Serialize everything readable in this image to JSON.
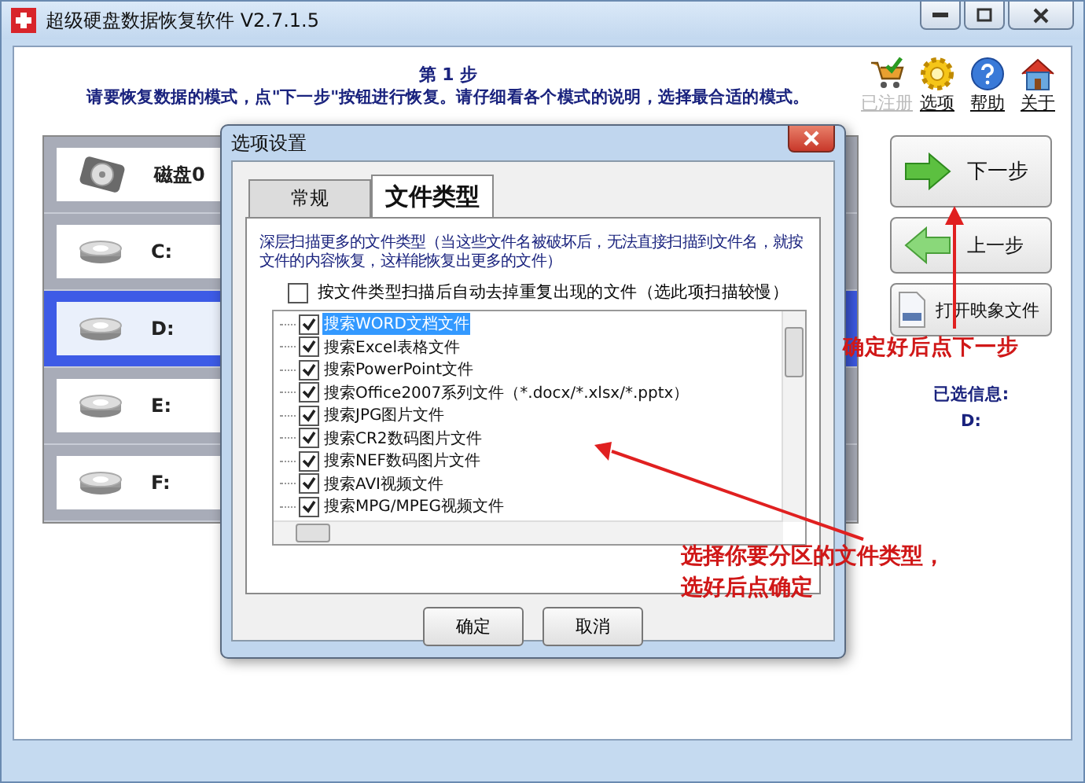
{
  "window": {
    "title": "超级硬盘数据恢复软件 V2.7.1.5"
  },
  "header": {
    "step": "第 1 步",
    "instruction": "请要恢复数据的模式，点\"下一步\"按钮进行恢复。请仔细看各个模式的说明，选择最合适的模式。"
  },
  "toolbar": [
    {
      "kind": "cart",
      "label": "已注册",
      "disabled": true
    },
    {
      "kind": "gear",
      "label": "选项",
      "disabled": false
    },
    {
      "kind": "help",
      "label": "帮助",
      "disabled": false
    },
    {
      "kind": "home",
      "label": "关于",
      "disabled": false
    }
  ],
  "drives": [
    {
      "kind": "disk",
      "label": "磁盘0",
      "selected": false
    },
    {
      "kind": "partition",
      "label": "C:",
      "selected": false
    },
    {
      "kind": "partition",
      "label": "D:",
      "selected": true
    },
    {
      "kind": "partition",
      "label": "E:",
      "selected": false
    },
    {
      "kind": "partition",
      "label": "F:",
      "selected": false
    }
  ],
  "actions": [
    {
      "kind": "next",
      "label": "下一步"
    },
    {
      "kind": "back",
      "label": "上一步"
    },
    {
      "kind": "image",
      "label": "打开映象文件"
    }
  ],
  "selected_info": {
    "label": "已选信息:",
    "value": "D:"
  },
  "dialog": {
    "title": "选项设置",
    "tabs": [
      {
        "label": "常规",
        "selected": false
      },
      {
        "label": "文件类型",
        "selected": true
      }
    ],
    "description": "深层扫描更多的文件类型（当这些文件名被破坏后，无法直接扫描到文件名，就按文件的内容恢复，这样能恢复出更多的文件）",
    "dedupe": {
      "label": "按文件类型扫描后自动去掉重复出现的文件（选此项扫描较慢）",
      "checked": false
    },
    "file_types": [
      {
        "label": "搜索WORD文档文件",
        "checked": true,
        "selected": true
      },
      {
        "label": "搜索Excel表格文件",
        "checked": true,
        "selected": false
      },
      {
        "label": "搜索PowerPoint文件",
        "checked": true,
        "selected": false
      },
      {
        "label": "搜索Office2007系列文件（*.docx/*.xlsx/*.pptx）",
        "checked": true,
        "selected": false
      },
      {
        "label": "搜索JPG图片文件",
        "checked": true,
        "selected": false
      },
      {
        "label": "搜索CR2数码图片文件",
        "checked": true,
        "selected": false
      },
      {
        "label": "搜索NEF数码图片文件",
        "checked": true,
        "selected": false
      },
      {
        "label": "搜索AVI视频文件",
        "checked": true,
        "selected": false
      },
      {
        "label": "搜索MPG/MPEG视频文件",
        "checked": true,
        "selected": false
      }
    ],
    "buttons": [
      "确定",
      "取消"
    ]
  },
  "annotations": [
    {
      "lines": [
        "确定好后点下一步"
      ]
    },
    {
      "lines": [
        "选择你要分区的文件类型，",
        "选好后点确定"
      ]
    }
  ]
}
